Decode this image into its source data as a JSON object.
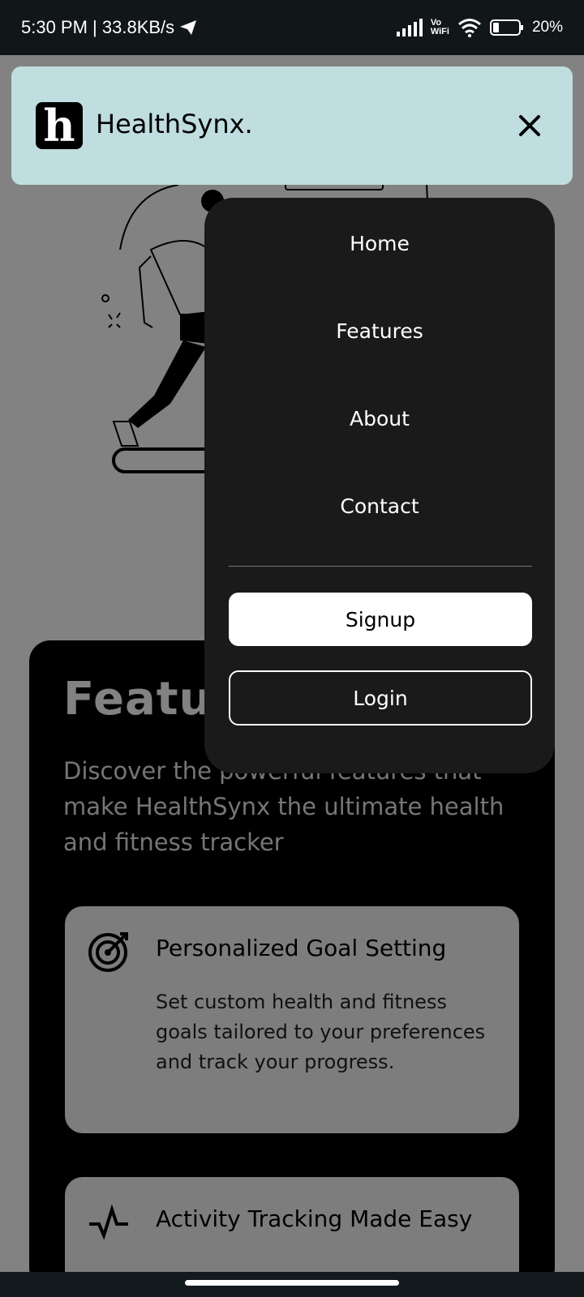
{
  "status_bar": {
    "time": "5:30 PM | 33.8KB/s",
    "vo": "Vo",
    "wifi": "WiFi",
    "battery": "20%"
  },
  "header": {
    "logo_letter": "h",
    "brand": "HealthSynx."
  },
  "menu": {
    "items": [
      {
        "label": "Home"
      },
      {
        "label": "Features"
      },
      {
        "label": "About"
      },
      {
        "label": "Contact"
      }
    ],
    "signup_label": "Signup",
    "login_label": "Login"
  },
  "features": {
    "title": "Features",
    "subtitle": "Discover the powerful features that make HealthSynx the ultimate health and fitness tracker",
    "cards": [
      {
        "icon": "target-icon",
        "title": "Personalized Goal Setting",
        "desc": "Set custom health and fitness goals tailored to your preferences and track your progress."
      },
      {
        "icon": "pulse-icon",
        "title": "Activity Tracking Made Easy"
      }
    ]
  }
}
